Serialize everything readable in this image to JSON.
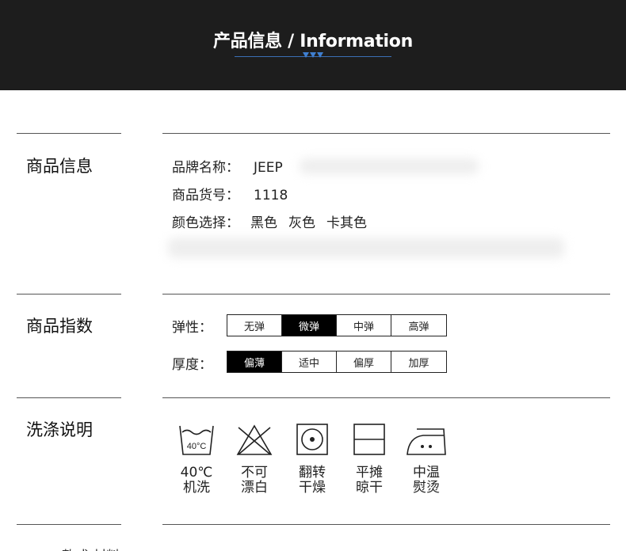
{
  "header": {
    "title": "产品信息 / Information"
  },
  "sections": {
    "product_info": {
      "title": "商品信息",
      "brand_label": "品牌名称：",
      "brand_value": "JEEP",
      "sku_label": "商品货号：",
      "sku_value": "1118",
      "color_label": "颜色选择：",
      "colors": [
        "黑色",
        "灰色",
        "卡其色"
      ]
    },
    "product_index": {
      "title": "商品指数",
      "elasticity_label": "弹性：",
      "elasticity_options": [
        "无弹",
        "微弹",
        "中弹",
        "高弹"
      ],
      "elasticity_selected": "微弹",
      "thickness_label": "厚度：",
      "thickness_options": [
        "偏薄",
        "适中",
        "偏厚",
        "加厚"
      ],
      "thickness_selected": "偏薄"
    },
    "washing": {
      "title": "洗涤说明",
      "items": [
        {
          "icon": "wash-tub-40c-icon",
          "tub_text": "40°C",
          "line1": "40℃",
          "line2": "机洗"
        },
        {
          "icon": "no-bleach-icon",
          "line1": "不可",
          "line2": "漂白"
        },
        {
          "icon": "tumble-dry-icon",
          "line1": "翻转",
          "line2": "干燥"
        },
        {
          "icon": "dry-flat-icon",
          "line1": "平摊",
          "line2": "晾干"
        },
        {
          "icon": "iron-medium-icon",
          "line1": "中温",
          "line2": "熨烫"
        }
      ]
    },
    "next_partial": {
      "text": "款式 材料"
    }
  },
  "colors": {
    "header_bg": "#1d1d1d",
    "accent_blue": "#3f7fd0",
    "selected_option_bg": "#000000"
  }
}
